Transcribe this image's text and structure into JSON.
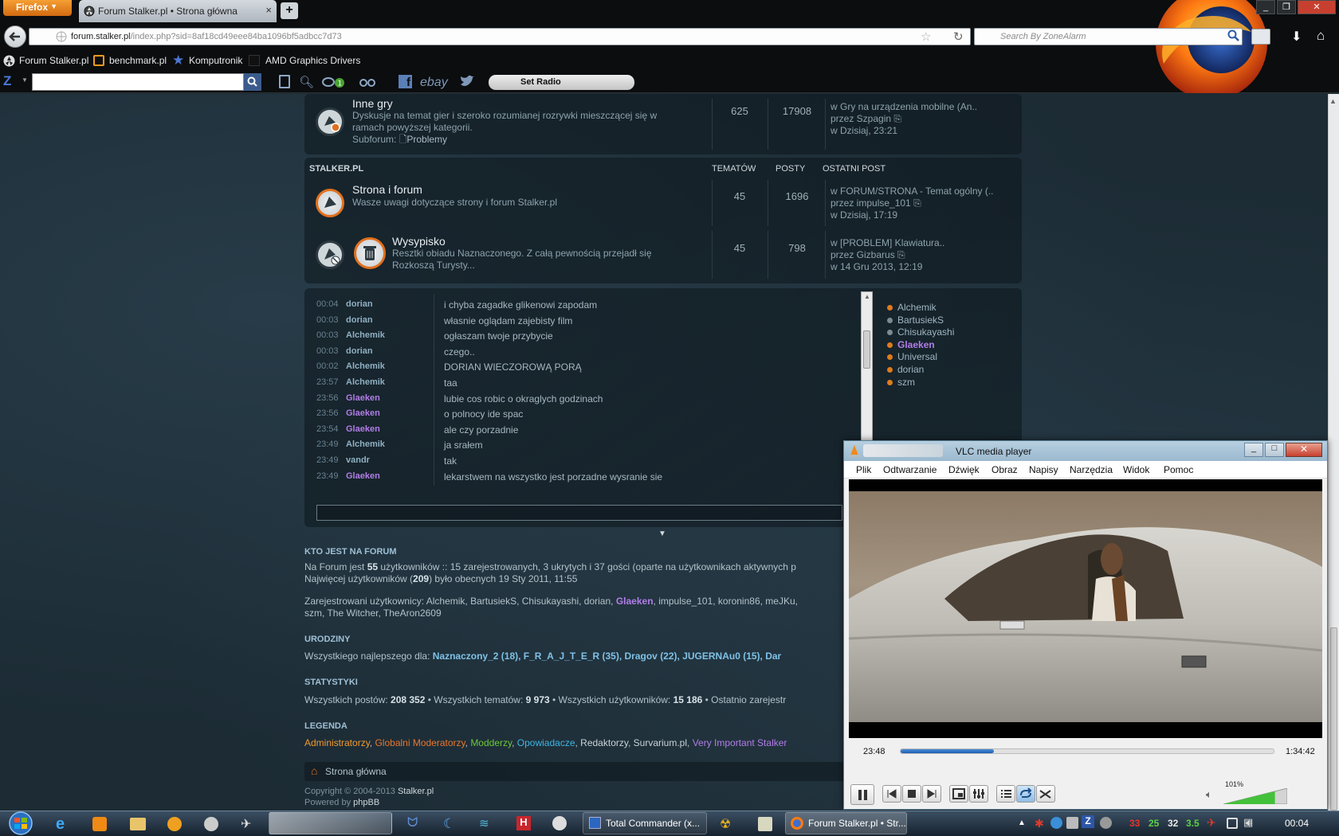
{
  "browser": {
    "menu_button": "Firefox",
    "tab_title": "Forum Stalker.pl • Strona główna",
    "new_tab": "+",
    "url_domain": "forum.stalker.pl",
    "url_path": "/index.php?sid=8af18cd49eee84ba1096bf5adbcc7d73",
    "search_placeholder": "Search By ZoneAlarm",
    "bookmarks": [
      "Forum Stalker.pl",
      "benchmark.pl",
      "Komputronik",
      "AMD Graphics Drivers"
    ],
    "toolbar_ebay": "ebay",
    "set_radio": "Set Radio"
  },
  "forum": {
    "inne_gry": {
      "title": "Inne gry",
      "desc1": "Dyskusje na temat gier i szeroko rozumianej rozrywki mieszczącej się w",
      "desc2": "ramach powyższej kategorii.",
      "subforum_label": "Subforum:",
      "subforum": "Problemy",
      "topics": "625",
      "posts": "17908",
      "last1": "w Gry na urządzenia mobilne (An..",
      "last2": "przez Szpagin",
      "last3": "w Dzisiaj, 23:21"
    },
    "category": {
      "name": "STALKER.PL",
      "col_topics": "TEMATÓW",
      "col_posts": "POSTY",
      "col_last": "OSTATNI POST"
    },
    "strona": {
      "title": "Strona i forum",
      "desc": "Wasze uwagi dotyczące strony i forum Stalker.pl",
      "topics": "45",
      "posts": "1696",
      "last1": "w FORUM/STRONA - Temat ogólny (..",
      "last2": "przez impulse_101",
      "last3": "w Dzisiaj, 17:19"
    },
    "wysypisko": {
      "title": "Wysypisko",
      "desc1": "Resztki obiadu Naznaczonego. Z całą pewnością przejadł się",
      "desc2": "Rozkoszą Turysty...",
      "topics": "45",
      "posts": "798",
      "last1": "w [PROBLEM] Klawiatura..",
      "last2": "przez Gizbarus",
      "last3": "w 14 Gru 2013, 12:19"
    }
  },
  "shoutbox": [
    {
      "time": "00:04",
      "name": "dorian",
      "msg": "i chyba zagadke glikenowi zapodam"
    },
    {
      "time": "00:03",
      "name": "dorian",
      "msg": "własnie oglądam zajebisty film"
    },
    {
      "time": "00:03",
      "name": "Alchemik",
      "msg": "ogłaszam twoje przybycie"
    },
    {
      "time": "00:03",
      "name": "dorian",
      "msg": "czego.."
    },
    {
      "time": "00:02",
      "name": "Alchemik",
      "msg": "DORIAN WIECZOROWĄ PORĄ"
    },
    {
      "time": "23:57",
      "name": "Alchemik",
      "msg": "taa"
    },
    {
      "time": "23:56",
      "name": "Glaeken",
      "msg": "lubie cos robic o okraglych godzinach"
    },
    {
      "time": "23:56",
      "name": "Glaeken",
      "msg": "o polnocy ide spac"
    },
    {
      "time": "23:54",
      "name": "Glaeken",
      "msg": "ale czy porzadnie"
    },
    {
      "time": "23:49",
      "name": "Alchemik",
      "msg": "ja srałem"
    },
    {
      "time": "23:49",
      "name": "vandr",
      "msg": "tak"
    },
    {
      "time": "23:49",
      "name": "Glaeken",
      "msg": "lekarstwem na wszystko jest porzadne wysranie sie"
    }
  ],
  "online_users": [
    "Alchemik",
    "BartusiekS",
    "Chisukayashi",
    "Glaeken",
    "Universal",
    "dorian",
    "szm"
  ],
  "who": {
    "title": "KTO JEST NA FORUM",
    "l1a": "Na Forum jest ",
    "l1b": "55",
    "l1c": " użytkowników :: 15 zarejestrowanych, 3 ukrytych i 37 gości (oparte na użytkownikach aktywnych p",
    "l2a": "Najwięcej użytkowników (",
    "l2b": "209",
    "l2c": ") było obecnych 19 Sty 2011, 11:55",
    "l3a": "Zarejestrowani użytkownicy: Alchemik, BartusiekS, Chisukayashi, dorian, ",
    "l3b": "Glaeken",
    "l3c": ", impulse_101, koronin86, meJKu,",
    "l4": "szm, The Witcher, TheAron2609"
  },
  "birthdays": {
    "title": "URODZINY",
    "lead": "Wszystkiego najlepszego dla: ",
    "names": "Naznaczony_2 (18), F_R_A_J_T_E_R (35), Dragov (22), JUGERNAu0 (15), Dar"
  },
  "stats": {
    "title": "STATYSTYKI",
    "a": "Wszystkich postów: ",
    "b": "208 352",
    "c": " • Wszystkich tematów: ",
    "d": "9 973",
    "e": " • Wszystkich użytkowników: ",
    "f": "15 186",
    "g": " • Ostatnio zarejestr"
  },
  "legend": {
    "title": "LEGENDA",
    "admins": "Administratorzy",
    "global_mods": "Globalni Moderatorzy",
    "mods": "Modderzy",
    "story": "Opowiadacze",
    "editors": "Redaktorzy",
    "survarium": "Survarium.pl",
    "vip": "Very Important Stalker",
    "sep": ", "
  },
  "footer": {
    "home": "Strona główna",
    "copyright": "Copyright © 2004-2013 ",
    "copyright_site": "Stalker.pl",
    "powered": "Powered by ",
    "phpbb": "phpBB"
  },
  "vlc": {
    "title": "VLC media player",
    "menu": [
      "Plik",
      "Odtwarzanie",
      "Dźwięk",
      "Obraz",
      "Napisy",
      "Narzędzia",
      "Widok",
      "Pomoc"
    ],
    "elapsed": "23:48",
    "total": "1:34:42",
    "progress": 0.25,
    "volume": "101%",
    "volume_level": 1.01
  },
  "taskbar": {
    "items": [
      "Total Commander (x...",
      "Forum Stalker.pl • Str..."
    ],
    "tray_nums": [
      "33",
      "25",
      "32",
      "3.5"
    ],
    "clock": "00:04"
  },
  "colors": {
    "accent_orange": "#e1701c",
    "glaeken_purple": "#b27de8",
    "link_blue": "#7fc1e6"
  }
}
